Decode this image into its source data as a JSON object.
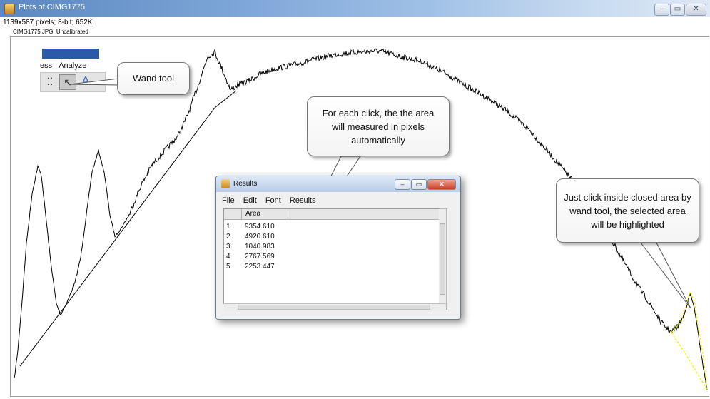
{
  "window": {
    "title": "Plots of CIMG1775",
    "image_info": "1139x587 pixels; 8-bit; 652K",
    "calibration_info": "CIMG1775.JPG, Uncalibrated",
    "controls": {
      "minimize": "–",
      "maximize": "▭",
      "close": "✕"
    }
  },
  "toolbar": {
    "menu": [
      "ess",
      "Analyze"
    ],
    "icons": [
      "points-icon",
      "wand-icon",
      "text-icon"
    ],
    "text_tool_glyph": "A"
  },
  "callouts": {
    "wand": "Wand tool",
    "area": "For each click, the the area will measured in pixels automatically",
    "click": "Just click inside closed area by wand tool, the selected area will be highlighted"
  },
  "results": {
    "title": "Results",
    "menu": [
      "File",
      "Edit",
      "Font",
      "Results"
    ],
    "column_header": "Area",
    "rows": [
      {
        "index": "1",
        "area": "9354.610"
      },
      {
        "index": "2",
        "area": "4920.610"
      },
      {
        "index": "3",
        "area": "1040.983"
      },
      {
        "index": "4",
        "area": "2767.569"
      },
      {
        "index": "5",
        "area": "2253.447"
      }
    ]
  },
  "colors": {
    "title_bar": "#5b88c2",
    "toolbar_accent": "#2a5aa8",
    "selection_highlight": "#f2f000",
    "plot_line": "#000000"
  }
}
